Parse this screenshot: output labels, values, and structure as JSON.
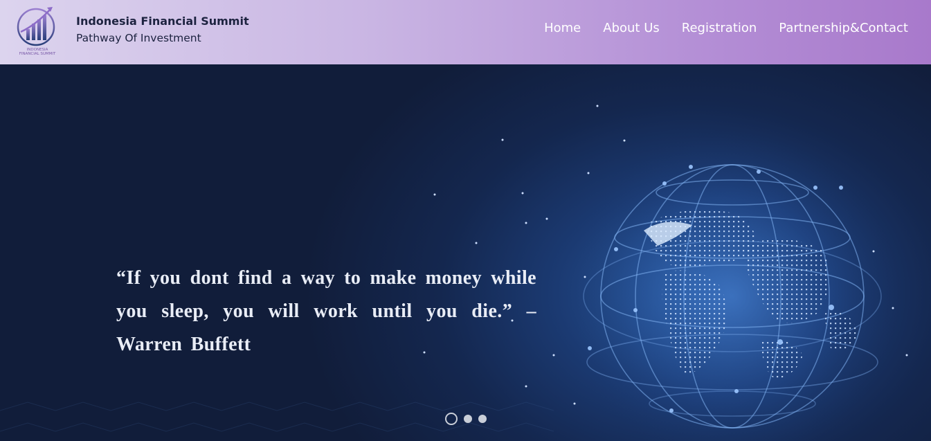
{
  "header": {
    "logo_caption": "INDONESIA FINANCIAL SUMMIT",
    "title": "Indonesia Financial Summit",
    "tagline": "Pathway Of Investment"
  },
  "nav": {
    "items": [
      {
        "label": "Home"
      },
      {
        "label": "About Us"
      },
      {
        "label": "Registration"
      },
      {
        "label": "Partnership&Contact"
      }
    ]
  },
  "hero": {
    "quote": "“If you dont find a way to make money while you sleep, you will work until you die.” – Warren Buffett",
    "slides_total": 3,
    "active_slide": 1
  },
  "colors": {
    "header_start": "#dcd4ee",
    "header_end": "#a879cb",
    "hero_bg": "#13203d",
    "text_dark": "#1d2340"
  }
}
